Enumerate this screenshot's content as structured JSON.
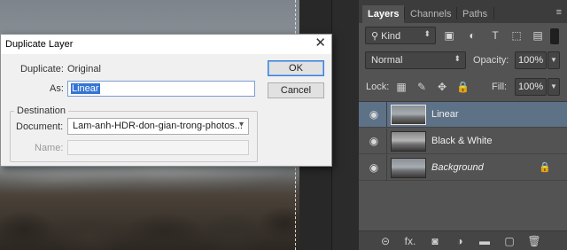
{
  "dialog": {
    "title": "Duplicate Layer",
    "duplicate_label": "Duplicate:",
    "duplicate_value": "Original",
    "as_label": "As:",
    "as_value": "Linear",
    "destination_legend": "Destination",
    "document_label": "Document:",
    "document_value": "Lam-anh-HDR-don-gian-trong-photos...",
    "name_label": "Name:",
    "ok_label": "OK",
    "cancel_label": "Cancel",
    "close_glyph": "✕"
  },
  "panel": {
    "tabs": [
      "Layers",
      "Channels",
      "Paths"
    ],
    "filter_label": "Kind",
    "blend_mode": "Normal",
    "opacity_label": "Opacity:",
    "opacity_value": "100%",
    "lock_label": "Lock:",
    "fill_label": "Fill:",
    "fill_value": "100%",
    "layers": [
      {
        "name": "Linear",
        "selected": true,
        "visible": true
      },
      {
        "name": "Black & White",
        "selected": false,
        "visible": true
      },
      {
        "name": "Background",
        "selected": false,
        "visible": true,
        "locked": true
      }
    ]
  },
  "icons": {
    "panel_menu": "≡",
    "filter_image": "▣",
    "filter_adjust": "◐",
    "filter_type": "T",
    "filter_shape": "⬚",
    "filter_smart": "▤",
    "lock_pixels": "▦",
    "lock_brush": "✎",
    "lock_move": "✥",
    "lock_all": "🔒",
    "eye": "◉",
    "footer_link": "⊝",
    "footer_fx": "fx.",
    "footer_mask": "◙",
    "footer_adjust": "◑",
    "footer_folder": "▬",
    "footer_new": "▢",
    "footer_trash": "🗑"
  },
  "colors": {
    "selection_highlight": "#3474d4",
    "selected_layer": "#5d7187",
    "panel_bg": "#535353"
  }
}
